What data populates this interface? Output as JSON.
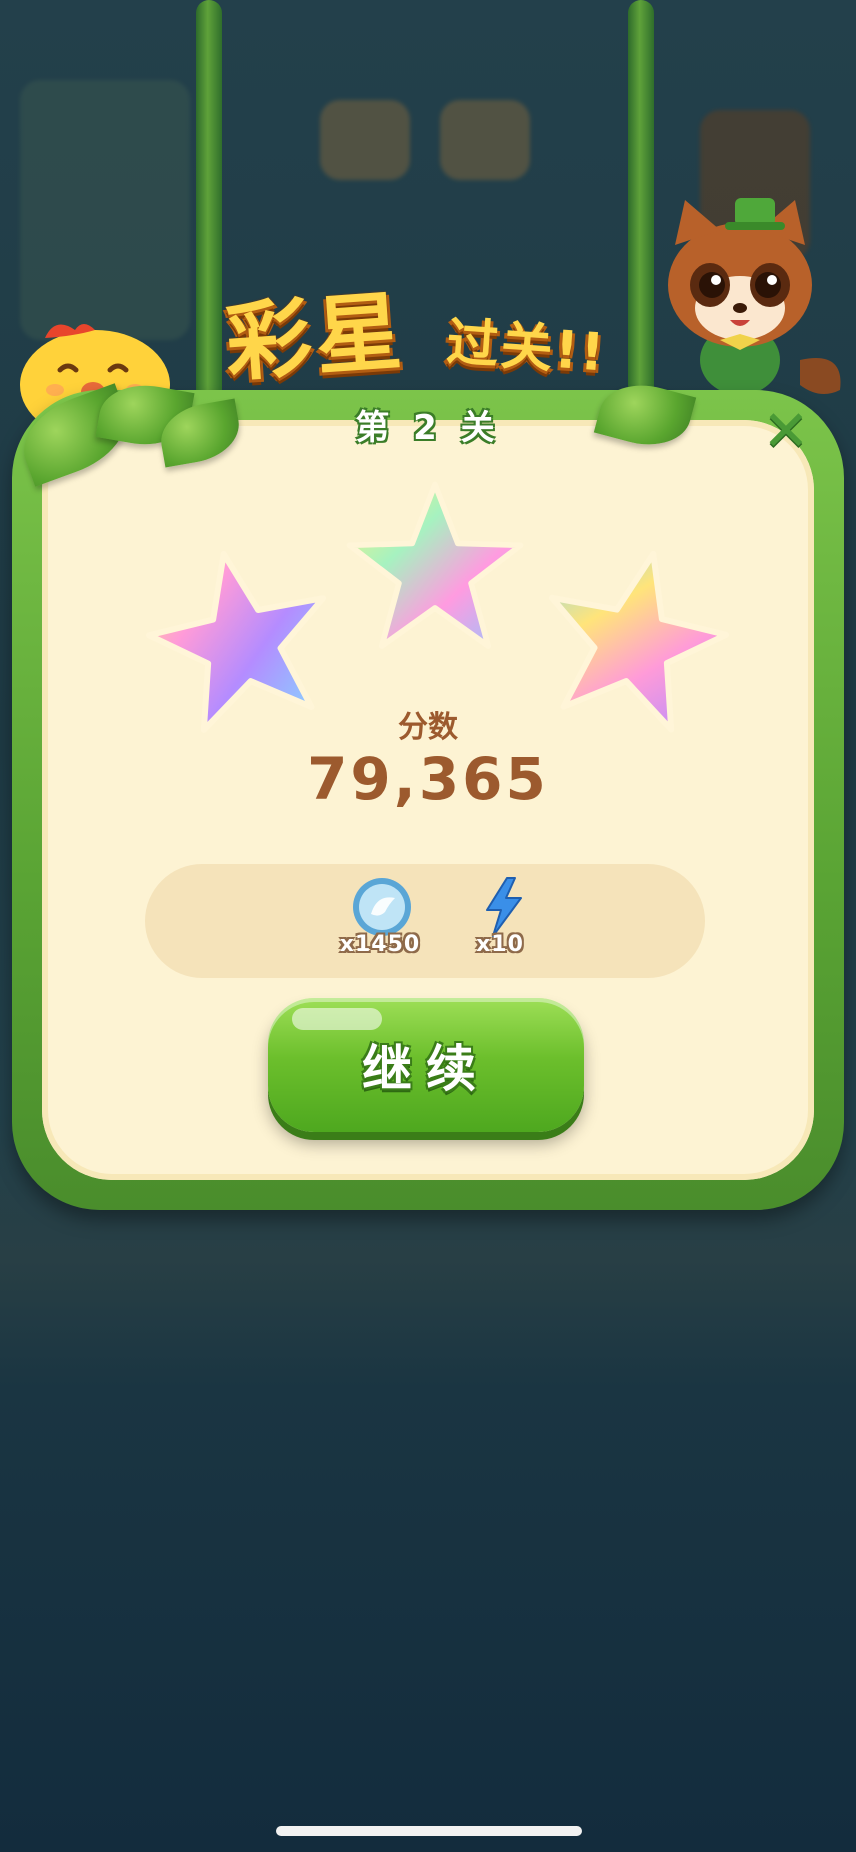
{
  "title": {
    "big": "彩星",
    "small": "过关!!"
  },
  "level_label": "第 2 关",
  "stars": {
    "earned": 3,
    "total": 3
  },
  "score": {
    "label": "分数",
    "value": "79,365"
  },
  "rewards": [
    {
      "icon": "silver-coin-icon",
      "count": "x1450"
    },
    {
      "icon": "lightning-icon",
      "count": "x10"
    }
  ],
  "continue_label": "继续",
  "close_icon": "close-icon",
  "colors": {
    "panel_bg": "#fdf3d3",
    "vine_green": "#5aa434",
    "score_brown": "#9c5a2e",
    "button_green": "#6cbf2c"
  }
}
